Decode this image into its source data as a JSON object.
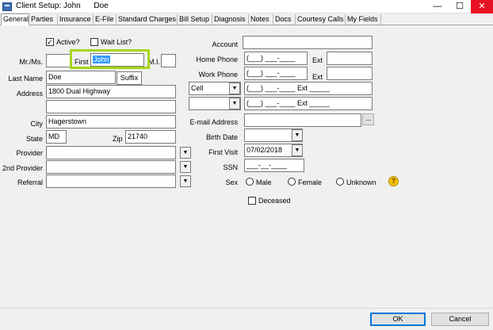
{
  "window": {
    "title": "Client Setup: John      Doe",
    "minimize": "—",
    "maximize": "☐",
    "close": "✕"
  },
  "tabs": [
    "General",
    "Parties",
    "Insurance",
    "E-File",
    "Standard Charges",
    "Bill Setup",
    "Diagnosis",
    "Notes",
    "Docs",
    "Courtesy Calls",
    "My Fields"
  ],
  "left": {
    "active_label": "Active?",
    "active_checked": true,
    "waitlist_label": "Wait List?",
    "waitlist_checked": false,
    "mrms_label": "Mr./Ms.",
    "mrms_value": "",
    "first_label": "First",
    "first_value": "John",
    "mi_label": "M.I.",
    "mi_value": "",
    "lastname_label": "Last Name",
    "lastname_value": "Doe",
    "suffix_label": "Suffix",
    "address_label": "Address",
    "address1_value": "1800 Dual Highway",
    "address2_value": "",
    "city_label": "City",
    "city_value": "Hagerstown",
    "state_label": "State",
    "state_value": "MD",
    "zip_label": "Zip",
    "zip_value": "21740",
    "provider_label": "Provider",
    "provider_value": "",
    "provider2_label": "2nd Provider",
    "provider2_value": "",
    "referral_label": "Referral",
    "referral_value": ""
  },
  "right": {
    "account_label": "Account",
    "account_value": "",
    "homephone_label": "Home Phone",
    "homephone_value": "(___) ___-____",
    "home_ext_label": "Ext",
    "home_ext_value": "",
    "workphone_label": "Work Phone",
    "workphone_value": "(___) ___-____",
    "work_ext_label": "Ext",
    "work_ext_value": "",
    "phone3_type": "Cell",
    "phone3_value": "(___) ___-____  Ext _____",
    "phone4_type": "",
    "phone4_value": "(___) ___-____  Ext _____",
    "email_label": "E-mail Address",
    "email_value": "",
    "email_btn": "...",
    "birthdate_label": "Birth Date",
    "birthdate_value": "",
    "firstvisit_label": "First Visit",
    "firstvisit_value": "07/02/2018",
    "ssn_label": "SSN",
    "ssn_value": "___-__-____",
    "sex_label": "Sex",
    "sex_options": [
      "Male",
      "Female",
      "Unknown"
    ],
    "deceased_label": "Deceased",
    "deceased_checked": false
  },
  "footer": {
    "ok_label": "OK",
    "cancel_label": "Cancel"
  },
  "icons": {
    "help": "help-icon",
    "dropdown": "chevron-down-icon"
  }
}
